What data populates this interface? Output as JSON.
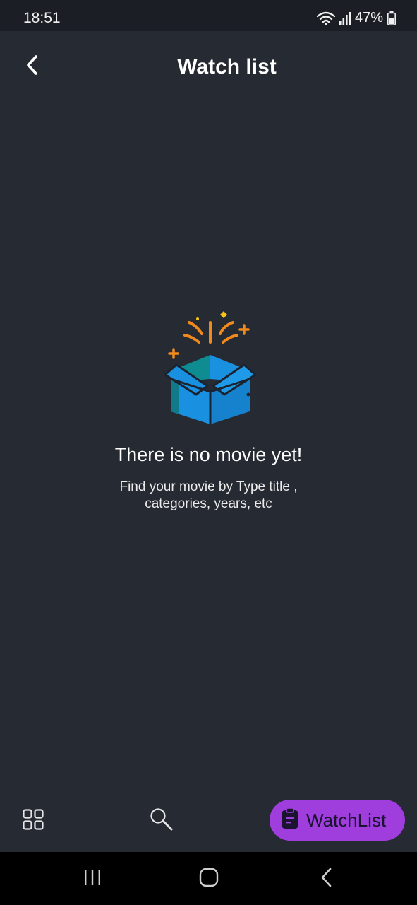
{
  "status_bar": {
    "time": "18:51",
    "battery": "47%"
  },
  "header": {
    "title": "Watch list"
  },
  "empty_state": {
    "title": "There is no movie yet!",
    "subtitle": "Find your movie by Type title , categories, years, etc"
  },
  "bottom_nav": {
    "items": [
      {
        "icon": "grid-icon"
      },
      {
        "icon": "search-icon"
      },
      {
        "icon": "clipboard-icon",
        "label": "WatchList",
        "active": true
      }
    ]
  },
  "colors": {
    "background": "#262a33",
    "status_bar": "#1b1e24",
    "accent": "#a03ddd",
    "box_blue": "#1a90e0",
    "spark_orange": "#f08a1c"
  }
}
